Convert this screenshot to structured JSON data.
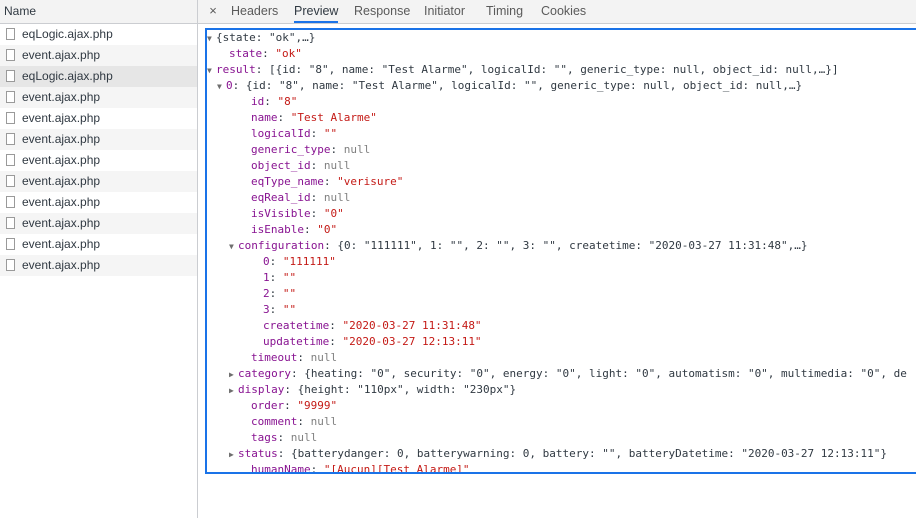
{
  "left_pane": {
    "header": "Name",
    "files": [
      {
        "name": "eqLogic.ajax.php"
      },
      {
        "name": "event.ajax.php"
      },
      {
        "name": "eqLogic.ajax.php"
      },
      {
        "name": "event.ajax.php"
      },
      {
        "name": "event.ajax.php"
      },
      {
        "name": "event.ajax.php"
      },
      {
        "name": "event.ajax.php"
      },
      {
        "name": "event.ajax.php"
      },
      {
        "name": "event.ajax.php"
      },
      {
        "name": "event.ajax.php"
      },
      {
        "name": "event.ajax.php"
      },
      {
        "name": "event.ajax.php"
      }
    ],
    "selected_index": 2
  },
  "tabs": {
    "close_glyph": "×",
    "items": [
      "Headers",
      "Preview",
      "Response",
      "Initiator",
      "Timing",
      "Cookies"
    ],
    "active": "Preview"
  },
  "preview": {
    "lines": [
      {
        "indent": 0,
        "tri": "down",
        "parts": [
          {
            "t": "{state: \"ok\",…}",
            "c": "p"
          }
        ]
      },
      {
        "indent": 1,
        "parts": [
          {
            "t": "state",
            "c": "k"
          },
          {
            "t": ": ",
            "c": "p"
          },
          {
            "t": "\"ok\"",
            "c": "s"
          }
        ]
      },
      {
        "indent": 1,
        "tri": "down",
        "parts": [
          {
            "t": "result",
            "c": "k"
          },
          {
            "t": ": [{id: \"8\", name: \"Test Alarme\", logicalId: \"\", generic_type: null, object_id: null,…}]",
            "c": "p"
          }
        ]
      },
      {
        "indent": 2,
        "tri": "down",
        "parts": [
          {
            "t": "0",
            "c": "k"
          },
          {
            "t": ": {id: \"8\", name: \"Test Alarme\", logicalId: \"\", generic_type: null, object_id: null,…}",
            "c": "p"
          }
        ]
      },
      {
        "indent": 3,
        "parts": [
          {
            "t": "id",
            "c": "k"
          },
          {
            "t": ": ",
            "c": "p"
          },
          {
            "t": "\"8\"",
            "c": "s"
          }
        ]
      },
      {
        "indent": 3,
        "parts": [
          {
            "t": "name",
            "c": "k"
          },
          {
            "t": ": ",
            "c": "p"
          },
          {
            "t": "\"Test Alarme\"",
            "c": "s"
          }
        ]
      },
      {
        "indent": 3,
        "parts": [
          {
            "t": "logicalId",
            "c": "k"
          },
          {
            "t": ": ",
            "c": "p"
          },
          {
            "t": "\"\"",
            "c": "s"
          }
        ]
      },
      {
        "indent": 3,
        "parts": [
          {
            "t": "generic_type",
            "c": "k"
          },
          {
            "t": ": ",
            "c": "p"
          },
          {
            "t": "null",
            "c": "n"
          }
        ]
      },
      {
        "indent": 3,
        "parts": [
          {
            "t": "object_id",
            "c": "k"
          },
          {
            "t": ": ",
            "c": "p"
          },
          {
            "t": "null",
            "c": "n"
          }
        ]
      },
      {
        "indent": 3,
        "parts": [
          {
            "t": "eqType_name",
            "c": "k"
          },
          {
            "t": ": ",
            "c": "p"
          },
          {
            "t": "\"verisure\"",
            "c": "s"
          }
        ]
      },
      {
        "indent": 3,
        "parts": [
          {
            "t": "eqReal_id",
            "c": "k"
          },
          {
            "t": ": ",
            "c": "p"
          },
          {
            "t": "null",
            "c": "n"
          }
        ]
      },
      {
        "indent": 3,
        "parts": [
          {
            "t": "isVisible",
            "c": "k"
          },
          {
            "t": ": ",
            "c": "p"
          },
          {
            "t": "\"0\"",
            "c": "s"
          }
        ]
      },
      {
        "indent": 3,
        "parts": [
          {
            "t": "isEnable",
            "c": "k"
          },
          {
            "t": ": ",
            "c": "p"
          },
          {
            "t": "\"0\"",
            "c": "s"
          }
        ]
      },
      {
        "indent": 3,
        "tri": "down",
        "parts": [
          {
            "t": "configuration",
            "c": "k"
          },
          {
            "t": ": {0: \"111111\", 1: \"\", 2: \"\", 3: \"\", createtime: \"2020-03-27 11:31:48\",…}",
            "c": "p"
          }
        ]
      },
      {
        "indent": 4,
        "parts": [
          {
            "t": "0",
            "c": "k"
          },
          {
            "t": ": ",
            "c": "p"
          },
          {
            "t": "\"111111\"",
            "c": "s"
          }
        ]
      },
      {
        "indent": 4,
        "parts": [
          {
            "t": "1",
            "c": "k"
          },
          {
            "t": ": ",
            "c": "p"
          },
          {
            "t": "\"\"",
            "c": "s"
          }
        ]
      },
      {
        "indent": 4,
        "parts": [
          {
            "t": "2",
            "c": "k"
          },
          {
            "t": ": ",
            "c": "p"
          },
          {
            "t": "\"\"",
            "c": "s"
          }
        ]
      },
      {
        "indent": 4,
        "parts": [
          {
            "t": "3",
            "c": "k"
          },
          {
            "t": ": ",
            "c": "p"
          },
          {
            "t": "\"\"",
            "c": "s"
          }
        ]
      },
      {
        "indent": 4,
        "parts": [
          {
            "t": "createtime",
            "c": "k"
          },
          {
            "t": ": ",
            "c": "p"
          },
          {
            "t": "\"2020-03-27 11:31:48\"",
            "c": "s"
          }
        ]
      },
      {
        "indent": 4,
        "parts": [
          {
            "t": "updatetime",
            "c": "k"
          },
          {
            "t": ": ",
            "c": "p"
          },
          {
            "t": "\"2020-03-27 12:13:11\"",
            "c": "s"
          }
        ]
      },
      {
        "indent": 3,
        "parts": [
          {
            "t": "timeout",
            "c": "k"
          },
          {
            "t": ": ",
            "c": "p"
          },
          {
            "t": "null",
            "c": "n"
          }
        ]
      },
      {
        "indent": 3,
        "tri": "right",
        "parts": [
          {
            "t": "category",
            "c": "k"
          },
          {
            "t": ": {heating: \"0\", security: \"0\", energy: \"0\", light: \"0\", automatism: \"0\", multimedia: \"0\", de",
            "c": "p"
          }
        ]
      },
      {
        "indent": 3,
        "tri": "right",
        "parts": [
          {
            "t": "display",
            "c": "k"
          },
          {
            "t": ": {height: \"110px\", width: \"230px\"}",
            "c": "p"
          }
        ]
      },
      {
        "indent": 3,
        "parts": [
          {
            "t": "order",
            "c": "k"
          },
          {
            "t": ": ",
            "c": "p"
          },
          {
            "t": "\"9999\"",
            "c": "s"
          }
        ]
      },
      {
        "indent": 3,
        "parts": [
          {
            "t": "comment",
            "c": "k"
          },
          {
            "t": ": ",
            "c": "p"
          },
          {
            "t": "null",
            "c": "n"
          }
        ]
      },
      {
        "indent": 3,
        "parts": [
          {
            "t": "tags",
            "c": "k"
          },
          {
            "t": ": ",
            "c": "p"
          },
          {
            "t": "null",
            "c": "n"
          }
        ]
      },
      {
        "indent": 3,
        "tri": "right",
        "parts": [
          {
            "t": "status",
            "c": "k"
          },
          {
            "t": ": {batterydanger: 0, batterywarning: 0, battery: \"\", batteryDatetime: \"2020-03-27 12:13:11\"}",
            "c": "p"
          }
        ]
      },
      {
        "indent": 3,
        "parts": [
          {
            "t": "humanName",
            "c": "k"
          },
          {
            "t": ": ",
            "c": "p"
          },
          {
            "t": "\"[Aucun][Test Alarme]\"",
            "c": "s"
          }
        ]
      }
    ]
  },
  "colors": {
    "accent": "#1a73e8",
    "key": "#881391",
    "string": "#c41a16",
    "null": "#808080"
  }
}
